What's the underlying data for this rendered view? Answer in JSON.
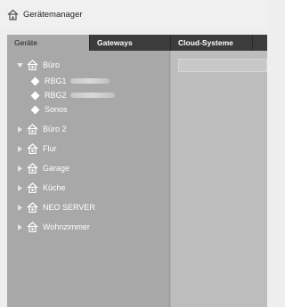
{
  "window": {
    "title": "Gerätemanager"
  },
  "tabs": [
    {
      "label": "Geräte",
      "active": true
    },
    {
      "label": "Gateways",
      "active": false
    },
    {
      "label": "Cloud-Systeme",
      "active": false
    }
  ],
  "tree": {
    "expanded_room": {
      "label": "Büro",
      "children": [
        {
          "label": "RBG1"
        },
        {
          "label": "RBG2"
        },
        {
          "label": "Sonos"
        }
      ]
    },
    "rooms": [
      {
        "label": "Büro 2"
      },
      {
        "label": "Flur"
      },
      {
        "label": "Garage"
      },
      {
        "label": "Küche"
      },
      {
        "label": "NEO SERVER"
      },
      {
        "label": "Wohnzimmer"
      }
    ]
  },
  "colors": {
    "tab_bar": "#3c3c3c",
    "tree_bg": "#a8a8a8",
    "text": "#ffffff"
  },
  "icons": {
    "app": "home-icon",
    "room": "house-icon",
    "device": "diamond-icon",
    "expand": "chevron-right-icon",
    "collapse": "chevron-down-icon"
  }
}
